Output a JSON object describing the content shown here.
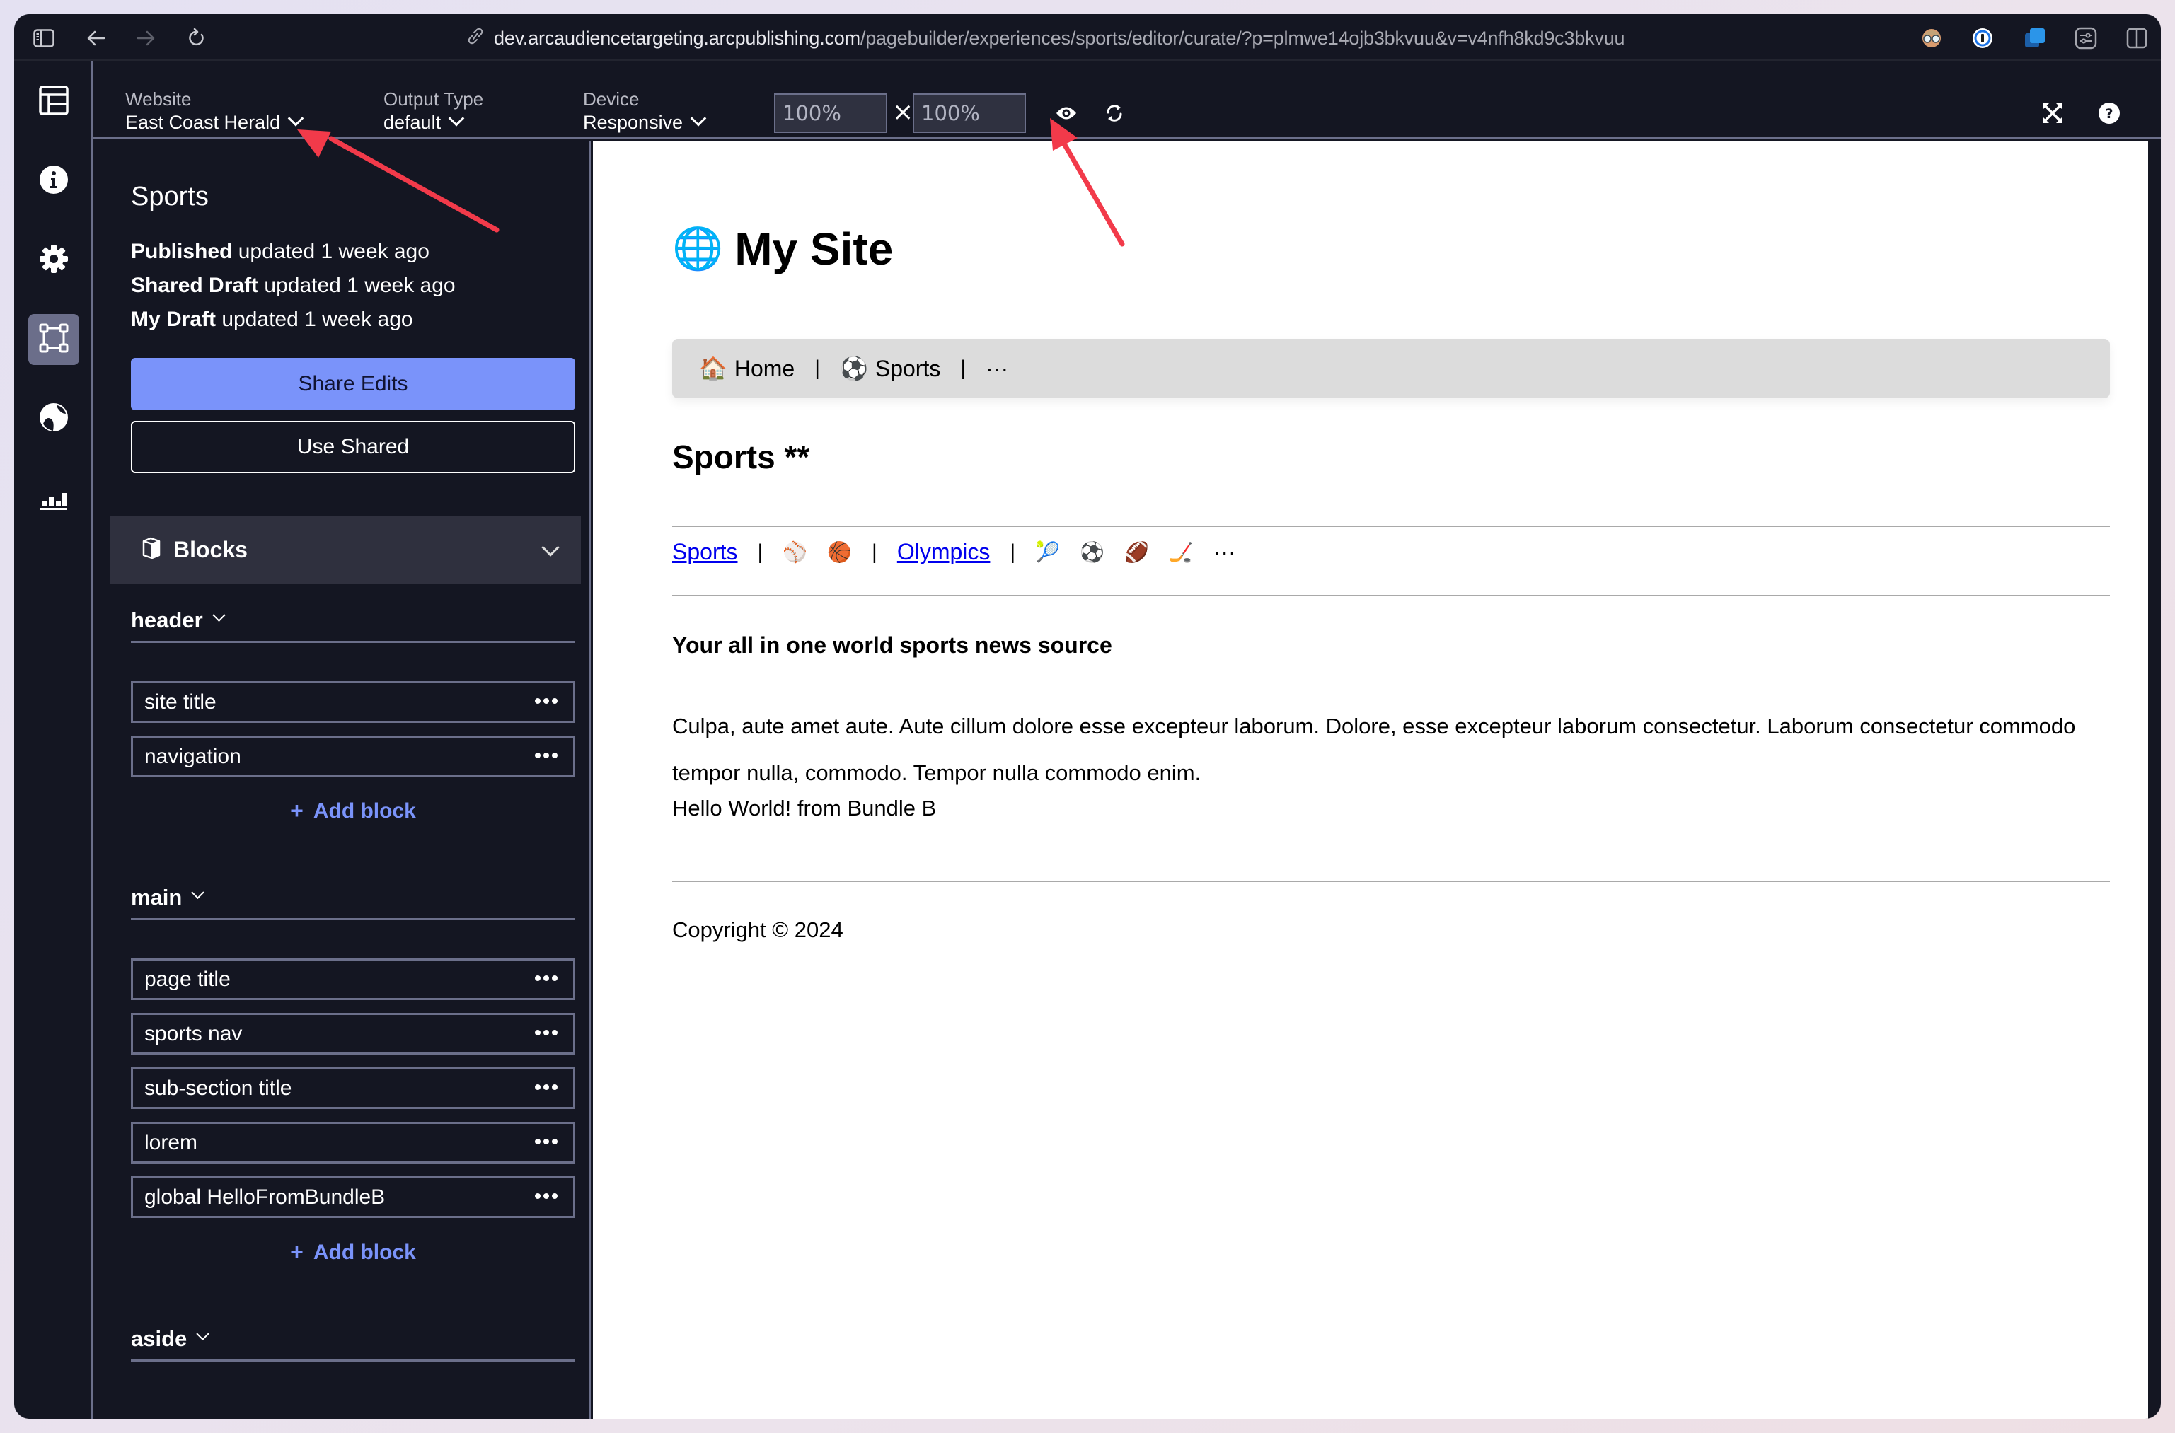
{
  "browser": {
    "url_host": "dev.arcaudiencetargeting.arcpublishing.com",
    "url_path": "/pagebuilder/experiences/sports/editor/curate/?p=plmwe14ojb3bkvuu&v=v4nfh8kd9c3bkvuu",
    "icons": [
      "sidebar-toggle-icon",
      "back-icon",
      "forward-icon",
      "reload-icon",
      "link-icon",
      "avatar-extension-icon",
      "password-manager-icon",
      "window-extension-icon",
      "settings-sliders-icon",
      "split-view-icon"
    ]
  },
  "toolbar": {
    "website": {
      "label": "Website",
      "value": "East Coast Herald"
    },
    "output_type": {
      "label": "Output Type",
      "value": "default"
    },
    "device": {
      "label": "Device",
      "value": "Responsive"
    },
    "width_value": "100%",
    "height_value": "100%",
    "times_symbol": "×",
    "icons": [
      "preview-eye-icon",
      "refresh-icon",
      "fullscreen-icon",
      "help-icon"
    ]
  },
  "rail": {
    "items": [
      {
        "name": "layout",
        "icon": "layout-icon",
        "active": false
      },
      {
        "name": "info",
        "icon": "info-icon",
        "active": false
      },
      {
        "name": "settings",
        "icon": "gear-icon",
        "active": false
      },
      {
        "name": "curate",
        "icon": "vector-square-icon",
        "active": true
      },
      {
        "name": "globe",
        "icon": "globe-icon",
        "active": false
      },
      {
        "name": "analytics",
        "icon": "bar-chart-icon",
        "active": false
      }
    ]
  },
  "panel": {
    "page_name": "Sports",
    "statuses": [
      {
        "label": "Published",
        "text": "updated 1 week ago"
      },
      {
        "label": "Shared Draft",
        "text": "updated 1 week ago"
      },
      {
        "label": "My Draft",
        "text": "updated 1 week ago"
      }
    ],
    "share_edits_label": "Share Edits",
    "use_shared_label": "Use Shared",
    "blocks_label": "Blocks",
    "add_block_label": "Add block",
    "sections": [
      {
        "name": "header",
        "blocks": [
          "site title",
          "navigation"
        ]
      },
      {
        "name": "main",
        "blocks": [
          "page title",
          "sports nav",
          "sub-section title",
          "lorem",
          "global HelloFromBundleB"
        ]
      },
      {
        "name": "aside",
        "blocks": []
      }
    ]
  },
  "preview": {
    "site_title": "My Site",
    "site_emoji": "🌐",
    "nav": [
      {
        "emoji": "🏠",
        "label": "Home"
      },
      {
        "emoji": "⚽",
        "label": "Sports"
      }
    ],
    "nav_separator": "|",
    "nav_more": "···",
    "page_title": "Sports **",
    "sports_nav": {
      "link1": "Sports",
      "group1_emojis": [
        "⚾",
        "🏀"
      ],
      "link2": "Olympics",
      "group2_emojis": [
        "🎾",
        "⚽",
        "🏈",
        "🏒"
      ],
      "more": "···"
    },
    "tagline": "Your all in one world sports news source",
    "lorem": "Culpa, aute amet aute. Aute cillum dolore esse excepteur laborum. Dolore, esse excepteur laborum consectetur. Laborum consectetur commodo tempor nulla, commodo. Tempor nulla commodo enim.",
    "hello": "Hello World! from Bundle B",
    "copyright": "Copyright © 2024"
  },
  "colors": {
    "app_bg": "#141622",
    "accent": "#7a93fa",
    "border": "#6b6f8a",
    "active_rail": "#6b6e8a",
    "annotation_red": "#f23a4a",
    "link_blue": "#0000ee"
  }
}
